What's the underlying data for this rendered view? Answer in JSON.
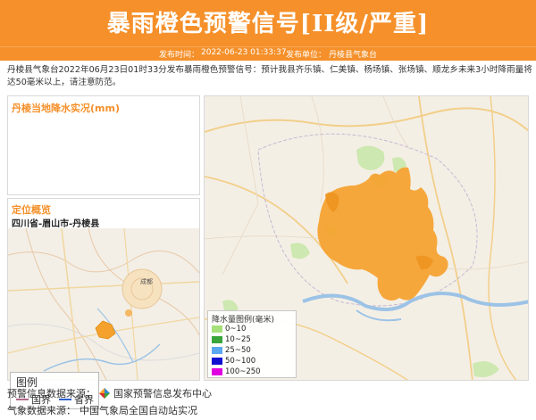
{
  "header": {
    "title": "暴雨橙色预警信号[II级/严重]",
    "publish_time_label": "发布时间：",
    "publish_time": "2022-06-23 01:33:37",
    "publisher_label": "发布单位：",
    "publisher": "丹棱县气象台"
  },
  "notice": "丹棱县气象台2022年06月23日01时33分发布暴雨橙色预警信号：预计我县齐乐镇、仁美镇、杨场镇、张场镇、顺龙乡未来3小时降雨量将达50毫米以上，请注意防范。",
  "rain_panel": {
    "title": "丹棱当地降水实况(mm)"
  },
  "location_panel": {
    "title": "定位概览",
    "location": "四川省-眉山市-丹棱县",
    "map_labels": [
      "成都"
    ],
    "legend": {
      "title": "图例",
      "items": [
        {
          "label": "国界",
          "color": "#b06a8a"
        },
        {
          "label": "省界",
          "color": "#2f5fd0"
        }
      ]
    }
  },
  "main_map": {
    "legend_title": "降水量图例(毫米)",
    "legend_items": [
      {
        "label": "0~10",
        "color": "#a6e07a"
      },
      {
        "label": "10~25",
        "color": "#3aa53a"
      },
      {
        "label": "25~50",
        "color": "#5aa8f0"
      },
      {
        "label": "50~100",
        "color": "#1010d0"
      },
      {
        "label": "100~250",
        "color": "#e000e0"
      }
    ],
    "warning_area_color": "#f5a12d"
  },
  "footer": {
    "source1_label": "预警信息数据来源：",
    "source1": "国家预警信息发布中心",
    "source2_label": "气象数据来源：",
    "source2": "中国气象局全国自动站实况"
  }
}
